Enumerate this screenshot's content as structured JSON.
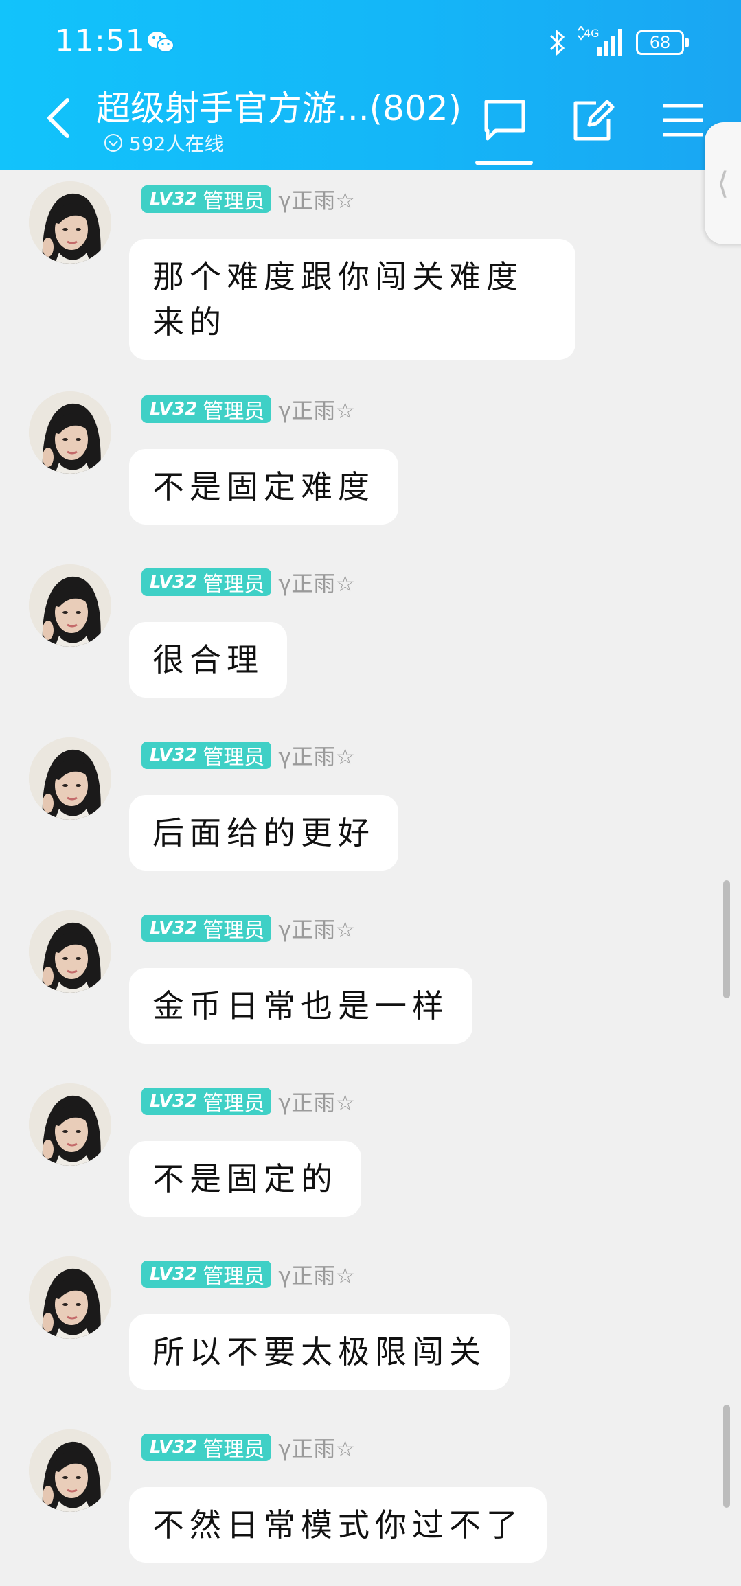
{
  "status_bar": {
    "time": "11:51",
    "network": "4G",
    "battery": "68"
  },
  "header": {
    "title": "超级射手官方游...(802)",
    "online": "592人在线",
    "back_icon": "chevron-left-icon",
    "actions": [
      "chat-icon",
      "edit-icon",
      "menu-icon"
    ]
  },
  "side_handle": {
    "glyph": "⟨"
  },
  "messages": [
    {
      "level": "LV32",
      "role": "管理员",
      "nick": "γ正雨☆",
      "text": "那个难度跟你闯关难度来的"
    },
    {
      "level": "LV32",
      "role": "管理员",
      "nick": "γ正雨☆",
      "text": "不是固定难度"
    },
    {
      "level": "LV32",
      "role": "管理员",
      "nick": "γ正雨☆",
      "text": "很合理"
    },
    {
      "level": "LV32",
      "role": "管理员",
      "nick": "γ正雨☆",
      "text": "后面给的更好"
    },
    {
      "level": "LV32",
      "role": "管理员",
      "nick": "γ正雨☆",
      "text": "金币日常也是一样"
    },
    {
      "level": "LV32",
      "role": "管理员",
      "nick": "γ正雨☆",
      "text": "不是固定的"
    },
    {
      "level": "LV32",
      "role": "管理员",
      "nick": "γ正雨☆",
      "text": "所以不要太极限闯关"
    },
    {
      "level": "LV32",
      "role": "管理员",
      "nick": "γ正雨☆",
      "text": "不然日常模式你过不了"
    }
  ],
  "colors": {
    "header": "#14b6f8",
    "badge": "#3fd0c6",
    "background": "#f0f0f0"
  }
}
